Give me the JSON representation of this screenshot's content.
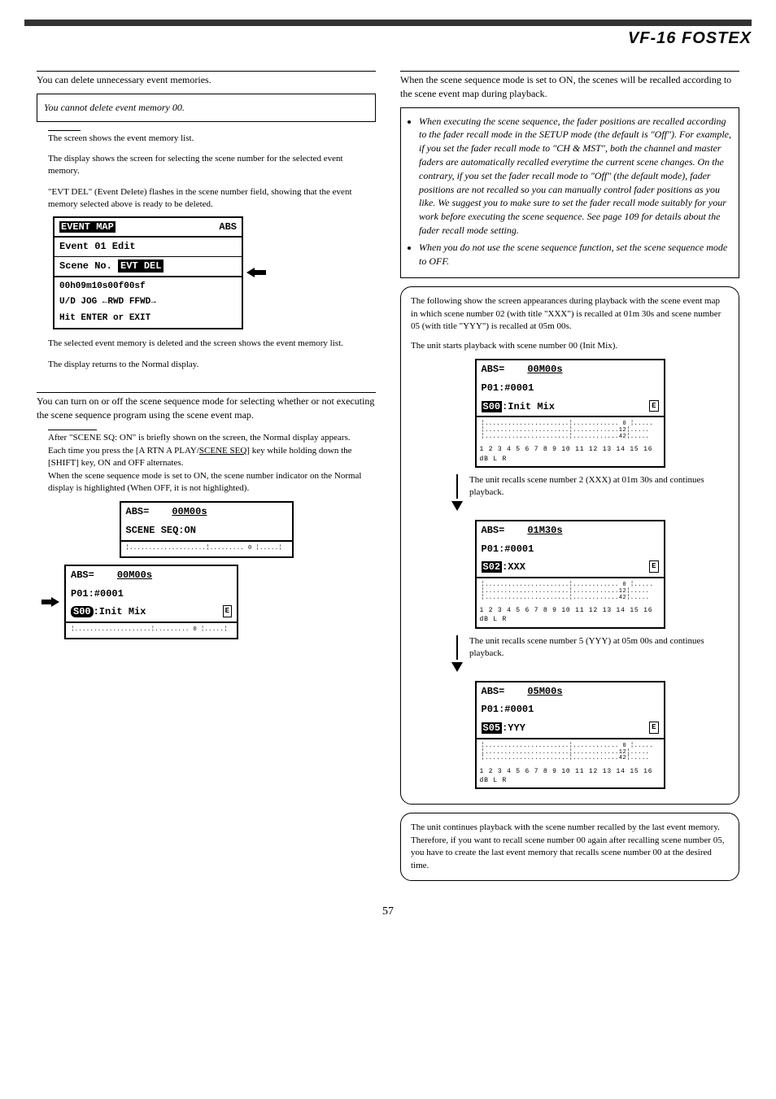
{
  "header": {
    "logo": "VF-16 FOSTEX"
  },
  "left": {
    "delete": {
      "title_prefix": "•",
      "intro": "You can delete unnecessary event memories.",
      "note": "You cannot delete event memory 00.",
      "step1a": "",
      "step1b": "The screen shows the event memory list.",
      "step2a": "",
      "step2b": "The display shows the screen for selecting the scene number for the selected event memory.",
      "step3a": "",
      "step3b": "\"EVT DEL\" (Event Delete) flashes in the scene number field, showing that the event memory selected above is ready to be deleted.",
      "lcd": {
        "l1a": "EVENT MAP",
        "l1b": "ABS",
        "l2": "Event 01 Edit",
        "l3a": "Scene No.",
        "l3b": "EVT DEL",
        "l4": "00h09m10s00f00sf",
        "l5": "U/D JOG ←RWD FFWD→",
        "l6": "Hit ENTER or EXIT"
      },
      "step4a": "",
      "step4b": "The selected event memory is deleted and the screen shows the event memory list.",
      "step5a": "",
      "step5b": "The display returns to the Normal display."
    },
    "onoff": {
      "intro": "You can turn on or off the scene sequence mode for selecting whether or not executing the scene sequence program using the scene event map.",
      "step1_top": "",
      "body1": "After \"SCENE SQ: ON\" is briefly shown on the screen, the Normal display appears.",
      "body2a": "Each time you press the [A RTN A PLAY/",
      "body2b": "SCENE SEQ",
      "body2c": "] key while holding down the [SHIFT] key, ON and OFF alternates.",
      "body3": "When the scene sequence mode is set to ON, the scene number indicator on the Normal display is highlighted (When OFF, it is not highlighted).",
      "lcd1": {
        "l1a": "ABS=",
        "l1b": "00M00s",
        "l2": "SCENE SEQ:ON"
      },
      "lcd2": {
        "l1a": "ABS=",
        "l1b": "00M00s",
        "l2": "P01:#0001",
        "l3a": "S00",
        "l3b": ":Init Mix",
        "eicon": "E"
      }
    }
  },
  "right": {
    "exec": {
      "intro": "When the scene sequence mode is set to ON, the scenes will be recalled according to the scene event map during playback.",
      "note_li1": "When executing the scene sequence, the fader positions are recalled according to the fader recall mode in the SETUP mode (the default is \"Off\"). For example, if you set the fader recall mode to \"CH & MST\", both the channel and master faders are automatically recalled everytime the current scene changes. On the contrary, if you set the fader recall mode to \"Off\" (the default mode), fader positions are not recalled so you can manually control fader positions as you like. We suggest you to make sure to set the fader recall mode suitably for your work before executing the scene sequence. See page 109 for details about the fader recall mode setting.",
      "note_li2": "When you do not use the scene sequence function, set the scene sequence mode to OFF.",
      "rbox_intro": "The following show the screen appearances during playback with the scene event map in which scene number 02 (with title \"XXX\") is recalled at 01m 30s and scene number 05 (with title \"YYY\") is recalled at 05m 00s.",
      "play_start": "The unit starts playback with scene number 00 (Init Mix).",
      "lcdA": {
        "time": "00M00s",
        "l2": "P01:#0001",
        "l3a": "S00",
        "l3b": ":Init Mix",
        "eicon": "E"
      },
      "flow1": "The unit recalls scene number 2 (XXX) at 01m 30s and continues playback.",
      "lcdB": {
        "time": "01M30s",
        "l2": "P01:#0001",
        "l3a": "S02",
        "l3b": ":XXX",
        "eicon": "E"
      },
      "flow2": "The unit recalls scene number 5 (YYY) at 05m 00s and continues playback.",
      "lcdC": {
        "time": "05M00s",
        "l2": "P01:#0001",
        "l3a": "S05",
        "l3b": ":YYY",
        "eicon": "E"
      },
      "meter_scale": "1 2 3 4 5 6 7 8  9 10 11 12 13 14 15 16  dB  L R",
      "tail_note": "The unit continues playback with the scene number recalled by the last event memory.\nTherefore, if you want to recall scene number 00 again after recalling scene number 05, you have to create the last event memory that recalls scene number 00 at the desired time."
    }
  },
  "page": "57"
}
